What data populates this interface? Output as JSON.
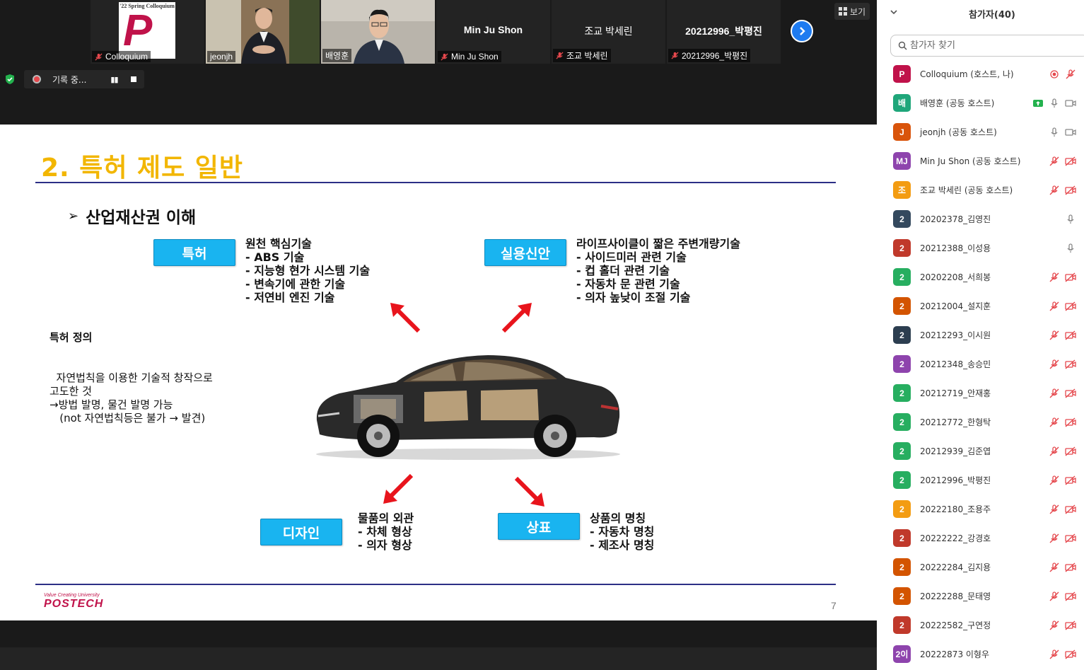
{
  "video_tiles": [
    {
      "label": "Colloquium",
      "muted": true,
      "logo_year": "'22 Spring Colloquium",
      "logo_letter": "P"
    },
    {
      "label": "jeonjh",
      "muted": false
    },
    {
      "label": "배영훈",
      "muted": false,
      "active": true
    },
    {
      "label": "Min Ju Shon",
      "center_name": "Min Ju Shon",
      "muted": true
    },
    {
      "label": "조교 박세린",
      "center_name": "조교 박세린",
      "muted": true
    },
    {
      "label": "20212996_박평진",
      "center_name": "20212996_박평진",
      "muted": true
    }
  ],
  "toolbar": {
    "view_label": "보기",
    "recording_label": "기록 중..."
  },
  "slide": {
    "title": "2. 특허 제도 일반",
    "bullet": "산업재산권 이해",
    "categories": [
      {
        "label": "특허",
        "lines": "원천 핵심기술\n- ABS 기술\n- 지능형 현가 시스템 기술\n- 변속기에 관한 기술\n- 저연비 엔진 기술"
      },
      {
        "label": "실용신안",
        "lines": "라이프사이클이 짧은 주변개량기술\n- 사이드미러 관련 기술\n- 컵 홀더 관련 기술\n- 자동차 문 관련 기술\n- 의자 높낮이 조절 기술"
      },
      {
        "label": "디자인",
        "lines": "물품의 외관\n- 차체 형상\n- 의자 형상"
      },
      {
        "label": "상표",
        "lines": "상품의 명칭\n- 자동차 명칭\n- 제조사 명칭"
      }
    ],
    "definition_title": "특허 정의",
    "definition_body": "  자연법칙을 이용한 기술적 창작으로\n고도한 것\n→방법 발명, 물건 발명 가능\n   (not 자연법칙등은 불가 → 발견)",
    "page_number": "7",
    "footer_tag": "Value Creating University",
    "footer_brand": "POSTECH"
  },
  "panel": {
    "title": "참가자(40)",
    "search_placeholder": "참가자 찾기",
    "participants": [
      {
        "initial": "P",
        "color": "#c0124a",
        "name": "Colloquium (호스트, 나)",
        "icons": [
          "rec",
          "mic-off"
        ]
      },
      {
        "initial": "배",
        "color": "#1fa67a",
        "name": "배영훈 (공동 호스트)",
        "icons": [
          "share",
          "mic",
          "cam"
        ]
      },
      {
        "initial": "J",
        "color": "#d9540b",
        "name": "jeonjh (공동 호스트)",
        "icons": [
          "mic",
          "cam"
        ]
      },
      {
        "initial": "MJ",
        "color": "#8e44ad",
        "name": "Min Ju Shon (공동 호스트)",
        "icons": [
          "mic-off",
          "cam-off"
        ]
      },
      {
        "initial": "조",
        "color": "#f39c12",
        "name": "조교 박세린 (공동 호스트)",
        "icons": [
          "mic-off",
          "cam-off"
        ]
      },
      {
        "initial": "2",
        "color": "#34495e",
        "name": "20202378_김영진",
        "icons": [
          "mic"
        ]
      },
      {
        "initial": "2",
        "color": "#c0392b",
        "name": "20212388_이성용",
        "icons": [
          "mic"
        ]
      },
      {
        "initial": "2",
        "color": "#27ae60",
        "name": "20202208_서희봉",
        "icons": [
          "mic-off",
          "cam-off"
        ]
      },
      {
        "initial": "2",
        "color": "#d35400",
        "name": "20212004_설지훈",
        "icons": [
          "mic-off",
          "cam-off"
        ]
      },
      {
        "initial": "2",
        "color": "#2c3e50",
        "name": "20212293_이시원",
        "icons": [
          "mic-off",
          "cam-off"
        ]
      },
      {
        "initial": "2",
        "color": "#8e44ad",
        "name": "20212348_송승민",
        "icons": [
          "mic-off",
          "cam-off"
        ]
      },
      {
        "initial": "2",
        "color": "#27ae60",
        "name": "20212719_안재홍",
        "icons": [
          "mic-off",
          "cam-off"
        ]
      },
      {
        "initial": "2",
        "color": "#27ae60",
        "name": "20212772_한형탁",
        "icons": [
          "mic-off",
          "cam-off"
        ]
      },
      {
        "initial": "2",
        "color": "#27ae60",
        "name": "20212939_김준엽",
        "icons": [
          "mic-off",
          "cam-off"
        ]
      },
      {
        "initial": "2",
        "color": "#27ae60",
        "name": "20212996_박평진",
        "icons": [
          "mic-off",
          "cam-off"
        ]
      },
      {
        "initial": "2",
        "color": "#f39c12",
        "name": "20222180_조용주",
        "icons": [
          "mic-off",
          "cam-off"
        ]
      },
      {
        "initial": "2",
        "color": "#c0392b",
        "name": "20222222_강경호",
        "icons": [
          "mic-off",
          "cam-off"
        ]
      },
      {
        "initial": "2",
        "color": "#d35400",
        "name": "20222284_김지용",
        "icons": [
          "mic-off",
          "cam-off"
        ]
      },
      {
        "initial": "2",
        "color": "#d35400",
        "name": "20222288_문태영",
        "icons": [
          "mic-off",
          "cam-off"
        ]
      },
      {
        "initial": "2",
        "color": "#c0392b",
        "name": "20222582_구연정",
        "icons": [
          "mic-off",
          "cam-off"
        ]
      },
      {
        "initial": "2이",
        "color": "#8e44ad",
        "name": "20222873 이형우",
        "icons": [
          "mic-off",
          "cam-off"
        ]
      }
    ]
  }
}
